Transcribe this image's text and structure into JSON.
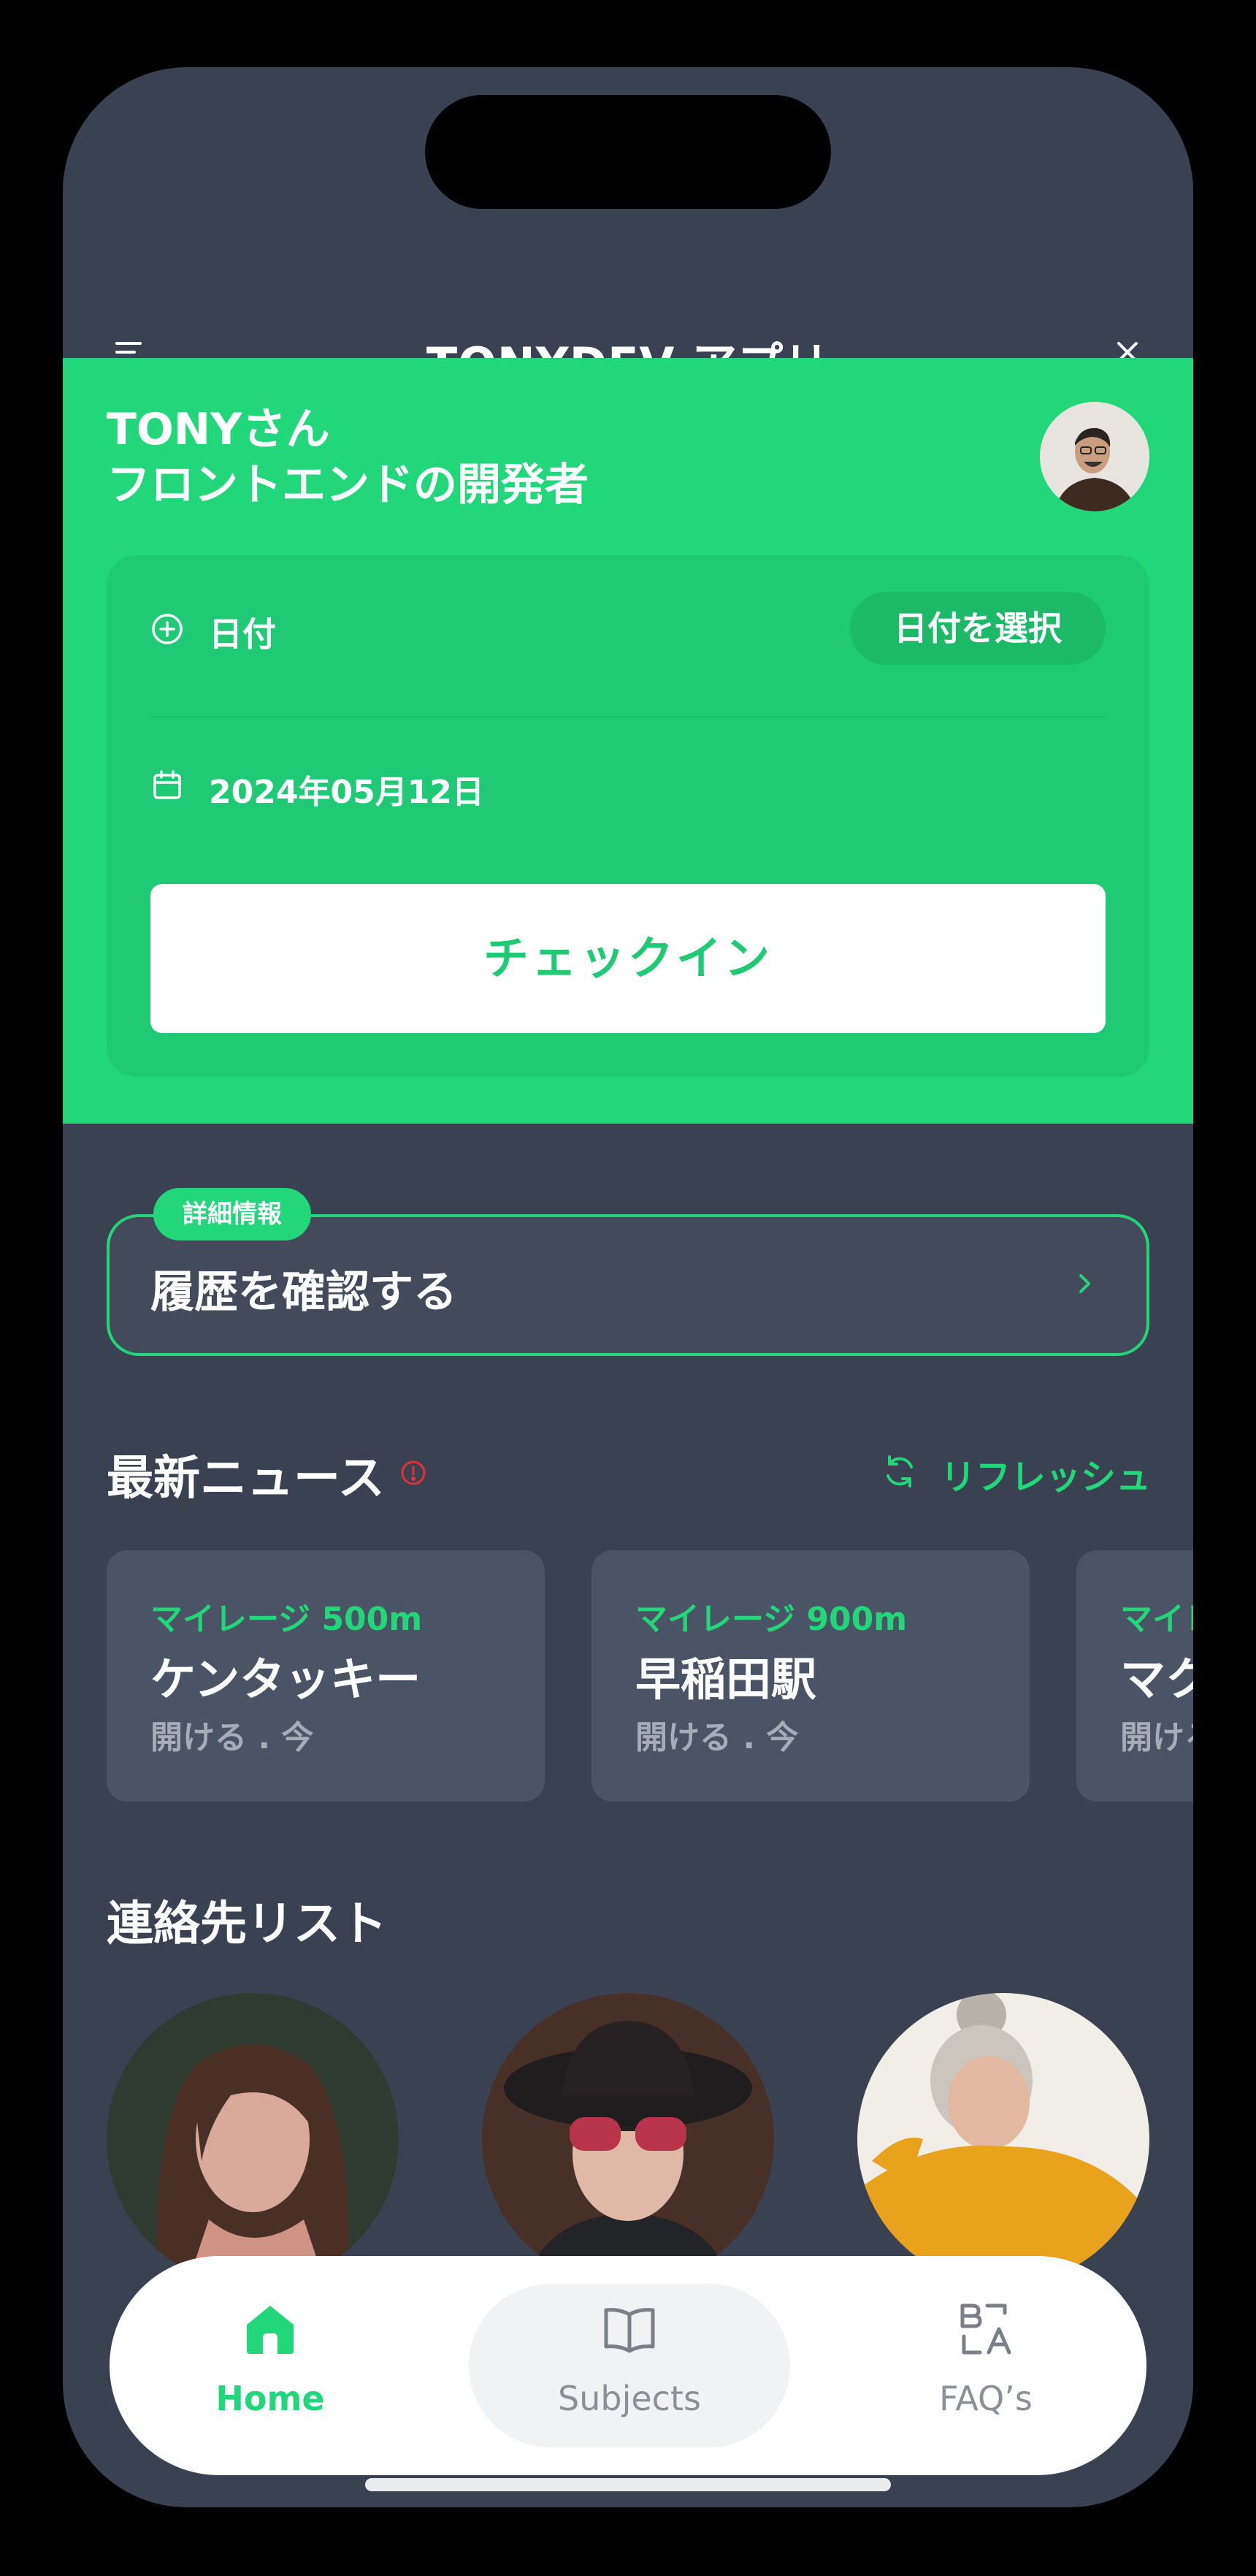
{
  "app": {
    "title": "TONYDEV アプリ"
  },
  "user": {
    "name_line": "TONYさん",
    "role_line": "フロントエンドの開発者"
  },
  "date_card": {
    "date_label": "日付",
    "select_date_button": "日付を選択",
    "selected_date": "2024年05月12日",
    "checkin_button": "チェックイン"
  },
  "history": {
    "badge": "詳細情報",
    "label": "履歴を確認する"
  },
  "news": {
    "title": "最新ニュース",
    "refresh_label": "リフレッシュ",
    "items": [
      {
        "mileage": "マイレージ 500m",
        "place": "ケンタッキー",
        "time": "開ける . 今"
      },
      {
        "mileage": "マイレージ 900m",
        "place": "早稲田駅",
        "time": "開ける . 今"
      },
      {
        "mileage": "マイレージ",
        "place": "マク",
        "time": "開ける"
      }
    ]
  },
  "contacts": {
    "title": "連絡先リスト"
  },
  "bottom_nav": {
    "items": [
      {
        "label": "Home",
        "icon": "home-icon",
        "active": true
      },
      {
        "label": "Subjects",
        "icon": "book-icon",
        "active": false
      },
      {
        "label": "FAQ’s",
        "icon": "translate-icon",
        "active": false
      }
    ]
  },
  "colors": {
    "accent": "#22d67a",
    "background": "#3a4251",
    "card": "#4b5464",
    "alert": "#e0313a"
  }
}
